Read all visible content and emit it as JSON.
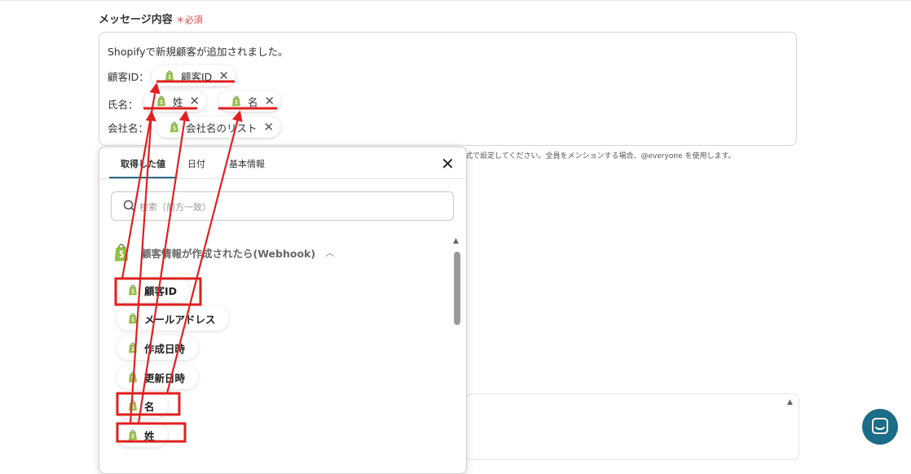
{
  "field": {
    "label": "メッセージ内容",
    "required": "＊必須"
  },
  "message": {
    "line1": "Shopifyで新規顧客が追加されました。",
    "customer_id_label": "顧客ID：",
    "customer_id_chip": "顧客ID",
    "name_label": "氏名：",
    "last_name_chip": "姓",
    "first_name_chip": "名",
    "company_label": "会社名：",
    "company_chip": "会社名のリスト"
  },
  "hint": "式で設定してください。全員をメンションする場合、@everyone を使用します。",
  "popup": {
    "tabs": [
      "取得した値",
      "日付",
      "基本情報"
    ],
    "search_placeholder": "検索（前方一致）",
    "group_title": "顧客情報が作成されたら(Webhook)",
    "items": [
      "顧客ID",
      "メールアドレス",
      "作成日時",
      "更新日時",
      "名",
      "姓"
    ]
  },
  "icons": {
    "brand": "shopify-icon",
    "close": "close-icon",
    "search": "search-icon",
    "chat": "chat-icon"
  },
  "colors": {
    "shopify_green": "#95bf47",
    "annotation_red": "#e02020",
    "accent": "#1b6c86"
  }
}
